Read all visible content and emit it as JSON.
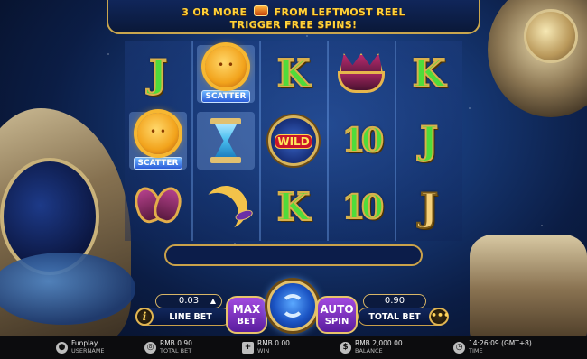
{
  "banner": {
    "line1_a": "3 OR MORE",
    "line1_b": "FROM LEFTMOST REEL",
    "line2": "TRIGGER FREE SPINS!"
  },
  "reels": [
    [
      {
        "kind": "letter",
        "text": "J",
        "color": "green"
      },
      {
        "kind": "scatter",
        "text": "SCATTER"
      },
      {
        "kind": "heart"
      }
    ],
    [
      {
        "kind": "scatter",
        "text": "SCATTER"
      },
      {
        "kind": "hourglass"
      },
      {
        "kind": "moon"
      }
    ],
    [
      {
        "kind": "letter",
        "text": "K",
        "color": "green"
      },
      {
        "kind": "wild",
        "text": "WILD"
      },
      {
        "kind": "letter",
        "text": "K",
        "color": "green"
      }
    ],
    [
      {
        "kind": "crown"
      },
      {
        "kind": "letter",
        "text": "10",
        "color": "green"
      },
      {
        "kind": "letter",
        "text": "10",
        "color": "green"
      }
    ],
    [
      {
        "kind": "letter",
        "text": "K",
        "color": "green"
      },
      {
        "kind": "letter",
        "text": "J",
        "color": "green"
      },
      {
        "kind": "letter",
        "text": "J",
        "color": "gold"
      }
    ]
  ],
  "controls": {
    "info_label": "i",
    "line_bet_value": "0.03",
    "line_bet_arrow": "▲",
    "line_bet_label": "LINE BET",
    "max_bet_line1": "MAX",
    "max_bet_line2": "BET",
    "auto_spin_line1": "AUTO",
    "auto_spin_line2": "SPIN",
    "total_bet_value": "0.90",
    "total_bet_label": "TOTAL BET",
    "more_label": "•••"
  },
  "status": {
    "username_value": "Funplay",
    "username_label": "USERNAME",
    "total_bet_value": "RMB 0.90",
    "total_bet_label": "TOTAL BET",
    "win_value": "RMB 0.00",
    "win_label": "WIN",
    "balance_value": "RMB 2,000.00",
    "balance_label": "BALANCE",
    "time_value": "14:26:09 (GMT+8)",
    "time_label": "TIME"
  },
  "icons": {
    "user": "user-icon",
    "total_bet": "coins-icon",
    "win": "plus-icon",
    "balance": "dollar-icon",
    "time": "clock-icon"
  }
}
